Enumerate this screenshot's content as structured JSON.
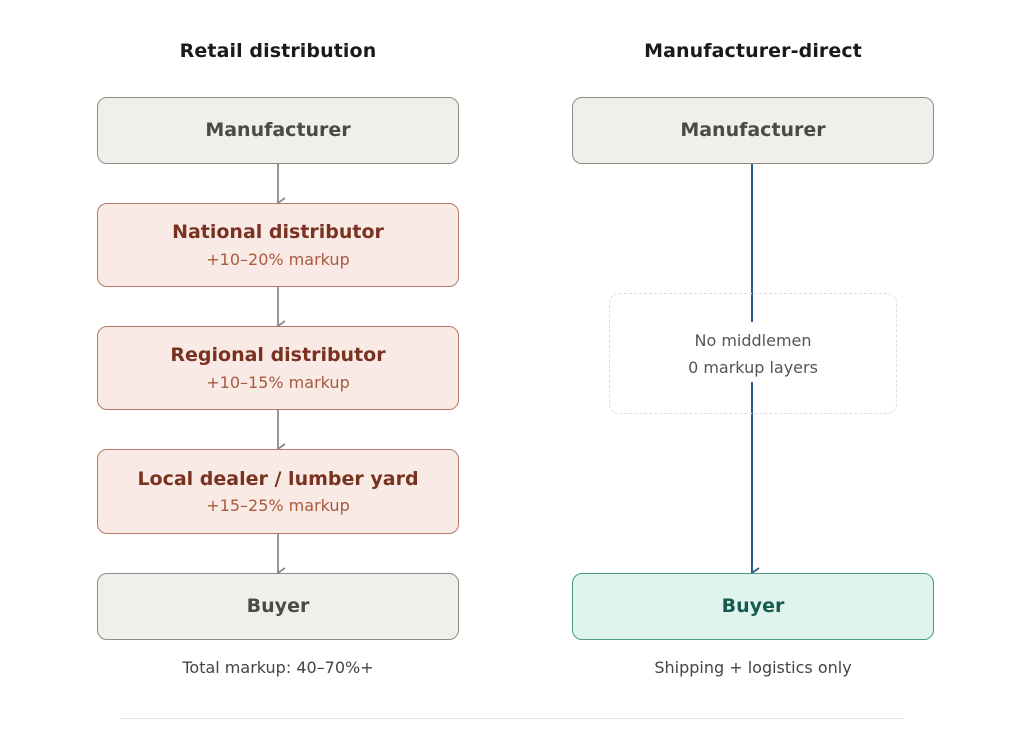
{
  "columns": {
    "retail": {
      "title": "Retail distribution",
      "boxes": [
        {
          "label": "Manufacturer",
          "markup": ""
        },
        {
          "label": "National distributor",
          "markup": "+10–20% markup"
        },
        {
          "label": "Regional distributor",
          "markup": "+10–15% markup"
        },
        {
          "label": "Local dealer / lumber yard",
          "markup": "+15–25% markup"
        },
        {
          "label": "Buyer",
          "markup": ""
        }
      ],
      "caption": "Total markup: 40–70%+"
    },
    "direct": {
      "title": "Manufacturer-direct",
      "boxes": [
        {
          "label": "Manufacturer"
        },
        {
          "label": "Buyer"
        }
      ],
      "note": {
        "line1": "No middlemen",
        "line2": "0 markup layers"
      },
      "caption": "Shipping + logistics only"
    }
  },
  "colors": {
    "neutral_fill": "#f0efea",
    "markup_fill": "#faeae6",
    "markup_text": "#7a3220",
    "direct_buyer_fill": "#e0f4ee",
    "direct_buyer_text": "#165a4f",
    "direct_arrow": "#2d5a8c",
    "retail_arrow": "#8a8a8a"
  }
}
